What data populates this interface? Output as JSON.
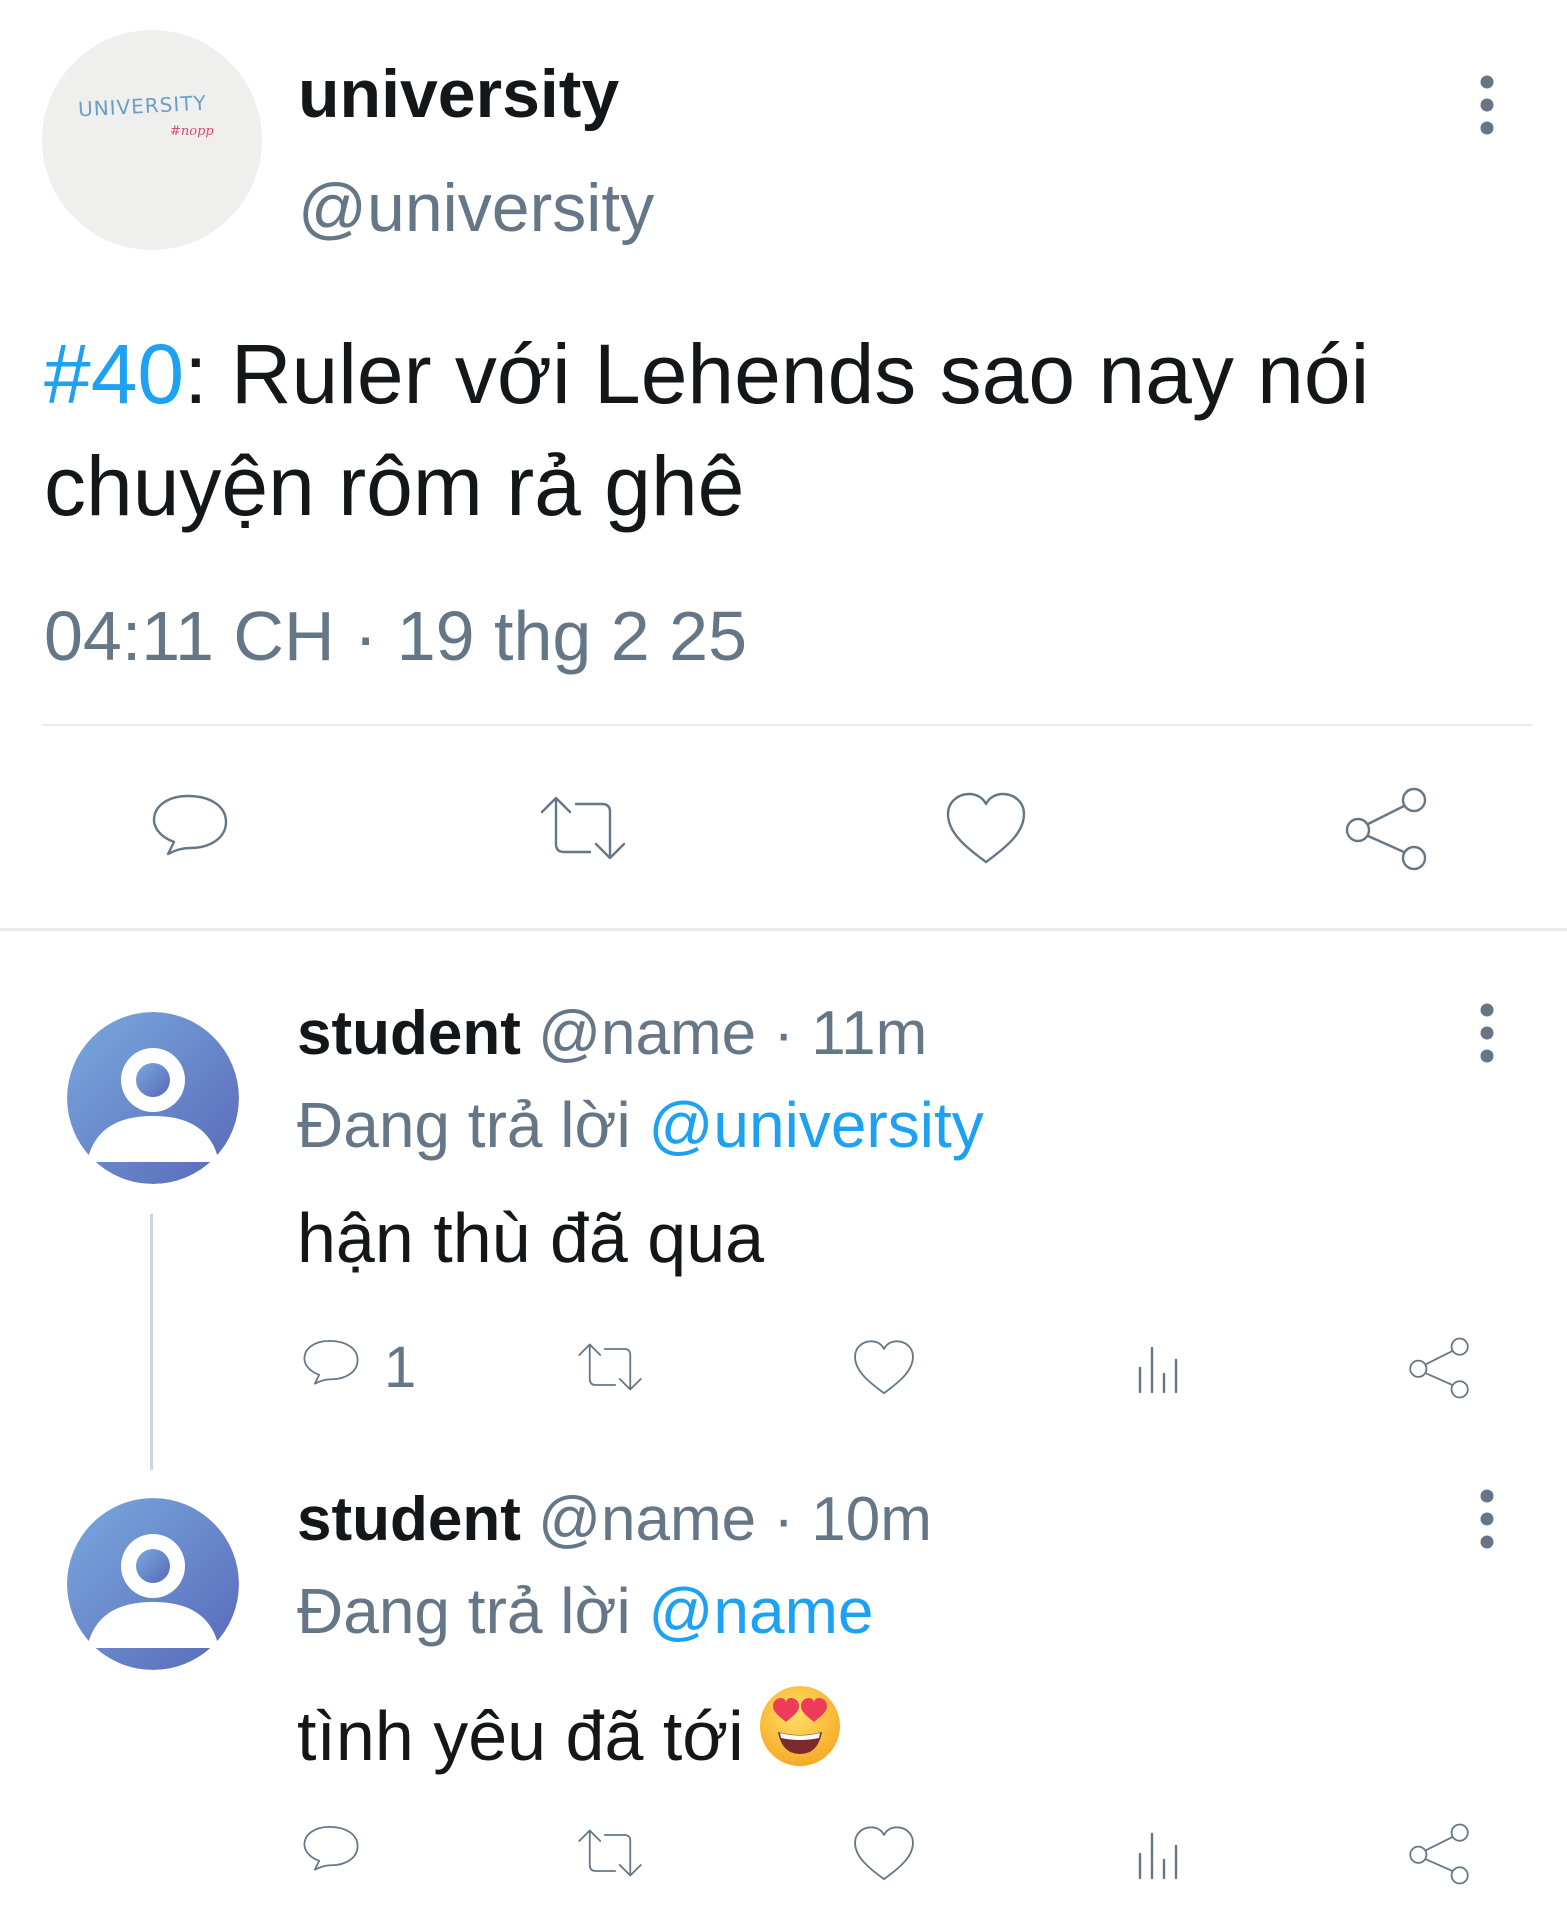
{
  "main_tweet": {
    "avatar": {
      "logo_text": "UNIVERSITY",
      "logo_sub": "#nopp"
    },
    "display_name": "university",
    "handle": "@university",
    "hashtag": "#40",
    "text": ": Ruler với Lehends sao nay nói chuyện rôm rả ghê",
    "timestamp": "04:11 CH · 19 thg 2 25",
    "actions": [
      "reply-icon",
      "retweet-icon",
      "like-icon",
      "share-icon"
    ]
  },
  "replies": [
    {
      "name": "student",
      "meta": " @name · 11m",
      "replying_prefix": "Đang trả lời ",
      "replying_to": "@university",
      "text": "hận thù đã qua",
      "emoji": "",
      "reply_count": "1",
      "actions": [
        "reply-icon",
        "retweet-icon",
        "like-icon",
        "analytics-icon",
        "share-icon"
      ]
    },
    {
      "name": "student",
      "meta": " @name · 10m",
      "replying_prefix": "Đang trả lời ",
      "replying_to": "@name",
      "text": "tình yêu đã tới",
      "emoji": "heart-eyes-emoji",
      "reply_count": "",
      "actions": [
        "reply-icon",
        "retweet-icon",
        "like-icon",
        "analytics-icon",
        "share-icon"
      ]
    }
  ],
  "colors": {
    "link": "#1da1f2",
    "secondary": "#657786",
    "text": "#14171a",
    "divider": "#e6ecf0",
    "avatar_gradient": [
      "#74a7dc",
      "#5a6fbd"
    ]
  }
}
